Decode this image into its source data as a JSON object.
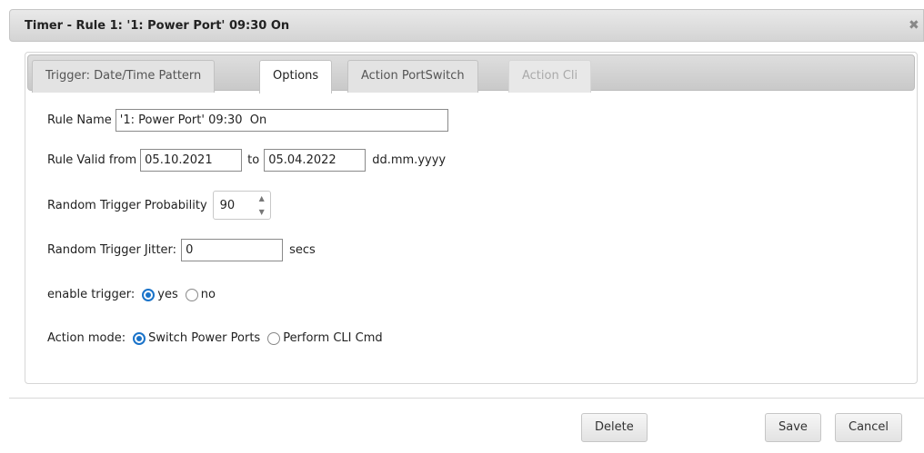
{
  "dialog": {
    "title": "Timer - Rule 1: '1: Power Port' 09:30 On",
    "close_glyph": "✖"
  },
  "tabs": [
    {
      "label": "Trigger: Date/Time Pattern",
      "state": "normal"
    },
    {
      "label": "Options",
      "state": "active"
    },
    {
      "label": "Action PortSwitch",
      "state": "normal"
    },
    {
      "label": "Action Cli",
      "state": "disabled"
    }
  ],
  "form": {
    "rule_name": {
      "label": "Rule Name",
      "value": "'1: Power Port' 09:30  On"
    },
    "valid": {
      "label": "Rule Valid from",
      "from_value": "05.10.2021",
      "to_label": "to",
      "to_value": "05.04.2022",
      "format_hint": "dd.mm.yyyy"
    },
    "probability": {
      "label": "Random Trigger Probability",
      "value": "90"
    },
    "jitter": {
      "label": "Random Trigger Jitter:",
      "value": "0",
      "unit": "secs"
    },
    "enable": {
      "label": "enable trigger:",
      "options": [
        "yes",
        "no"
      ],
      "selected": "yes"
    },
    "action_mode": {
      "label": "Action mode:",
      "options": [
        "Switch Power Ports",
        "Perform CLI Cmd"
      ],
      "selected": "Switch Power Ports"
    }
  },
  "footer": {
    "delete_label": "Delete",
    "save_label": "Save",
    "cancel_label": "Cancel"
  },
  "colors": {
    "accent": "#1a73c9",
    "titlebar": "#dcdcdc"
  }
}
